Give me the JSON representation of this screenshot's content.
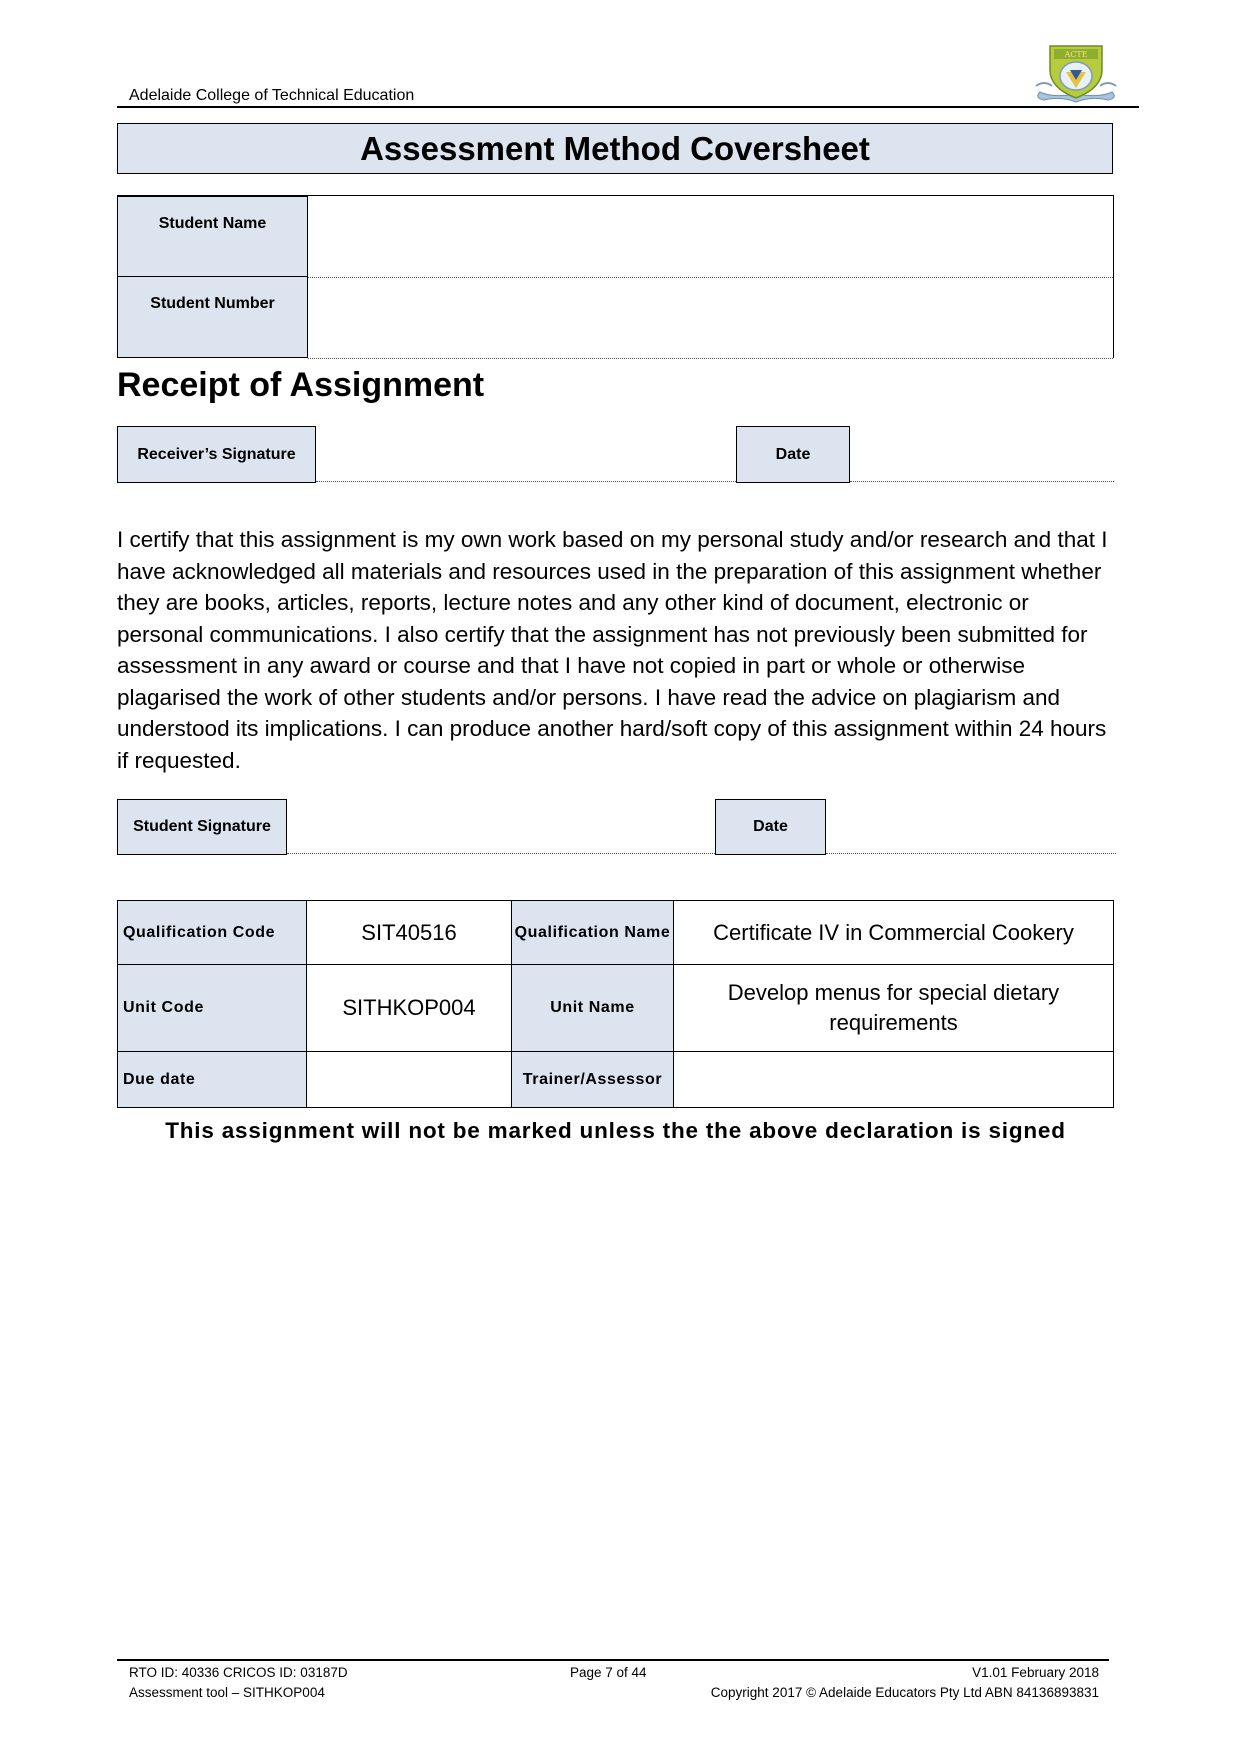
{
  "header": {
    "org_name": "Adelaide College of Technical Education",
    "logo": "college-crest-logo"
  },
  "title": "Assessment Method Coversheet",
  "student": {
    "name_label": "Student Name",
    "name_value": "",
    "number_label": "Student Number",
    "number_value": ""
  },
  "receipt": {
    "heading": "Receipt of Assignment",
    "receiver_signature_label": "Receiver’s Signature",
    "date_label": "Date"
  },
  "declaration": {
    "text": "I certify that this assignment is my own work based on my personal study and/or research and that I have acknowledged all materials and resources used in the preparation of this assignment whether they are books, articles, reports, lecture notes and any other kind of document, electronic or personal communications. I also certify that the assignment has not previously been submitted for assessment in any award or course and that I have not copied in part or whole or otherwise plagarised the work of other students and/or persons. I have read the advice on plagiarism and understood its implications. I can produce another hard/soft copy of this assignment within 24 hours if requested.",
    "student_signature_label": "Student Signature",
    "date_label": "Date"
  },
  "info_table": {
    "qualification_code_label": "Qualification Code",
    "qualification_code": "SIT40516",
    "qualification_name_label": "Qualification Name",
    "qualification_name": "Certificate IV in Commercial Cookery",
    "unit_code_label": "Unit Code",
    "unit_code": "SITHKOP004",
    "unit_name_label": "Unit Name",
    "unit_name": "Develop menus for special dietary requirements",
    "due_date_label": "Due date",
    "due_date": "",
    "trainer_label": "Trainer/Assessor",
    "trainer": ""
  },
  "notice": "This assignment will not be marked unless the the above declaration is signed",
  "footer": {
    "rto": "RTO ID: 40336 CRICOS ID: 03187D",
    "tool": "Assessment tool – SITHKOP004",
    "page": "Page 7 of 44",
    "version": "V1.01 February 2018",
    "copyright": "Copyright 2017 © Adelaide Educators Pty Ltd ABN 84136893831"
  },
  "colors": {
    "label_fill": "#dce4f0",
    "border": "#000000"
  }
}
